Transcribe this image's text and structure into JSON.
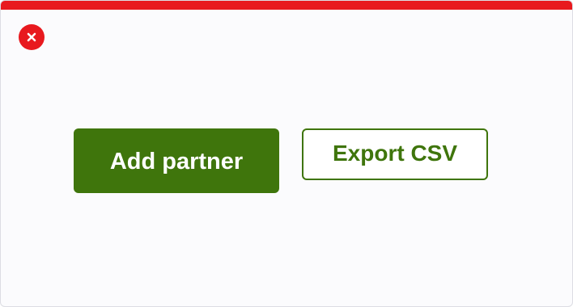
{
  "colors": {
    "accent_red": "#e8191e",
    "primary_green": "#3f750c",
    "background": "#fbfbfd"
  },
  "close": {
    "icon": "close-icon"
  },
  "actions": {
    "add_partner_label": "Add partner",
    "export_csv_label": "Export CSV"
  }
}
